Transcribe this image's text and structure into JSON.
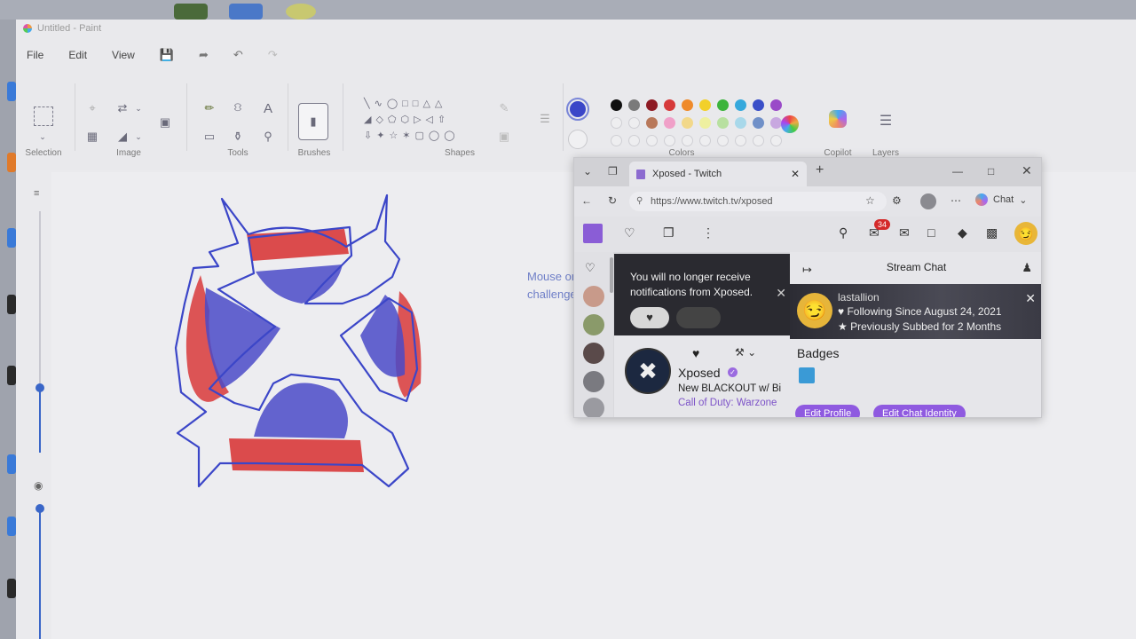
{
  "paint": {
    "title": "Untitled - Paint",
    "menu": {
      "file": "File",
      "edit": "Edit",
      "view": "View"
    },
    "groups": {
      "selection": "Selection",
      "image": "Image",
      "tools": "Tools",
      "brushes": "Brushes",
      "shapes": "Shapes",
      "colors": "Colors",
      "copilot": "Copilot",
      "layers": "Layers"
    },
    "palette_row1": [
      "#111111",
      "#7a7a7a",
      "#8e1b24",
      "#d63a3a",
      "#ef8a2a",
      "#f2d02a",
      "#3cb43c",
      "#35a8dc",
      "#3a4fc8",
      "#9a4ac8"
    ],
    "palette_row2": [
      "",
      "",
      "#b8785a",
      "#f0a0c8",
      "#f2d88a",
      "#eef0a0",
      "#b8e0a0",
      "#a8d8ea",
      "#7090c8",
      "#c8a8e0"
    ],
    "active_color": "#3b46c8",
    "canvas_text": "Mouse only challenge"
  },
  "browser": {
    "tab_title": "Xposed - Twitch",
    "url": "https://www.twitch.tv/xposed",
    "chat_label": "Chat",
    "notification_badge": "34",
    "notification_text": "You will no longer receive notifications from Xposed.",
    "channel": {
      "name": "Xposed",
      "stream_title": "New BLACKOUT w/ Bi",
      "game": "Call of Duty: Warzone"
    },
    "chat": {
      "title": "Stream Chat",
      "username": "lastallion",
      "following": "Following Since August 24, 2021",
      "subbed": "Previously Subbed for 2 Months",
      "badges_title": "Badges",
      "edit_profile": "Edit Profile",
      "edit_identity": "Edit Chat Identity"
    }
  }
}
